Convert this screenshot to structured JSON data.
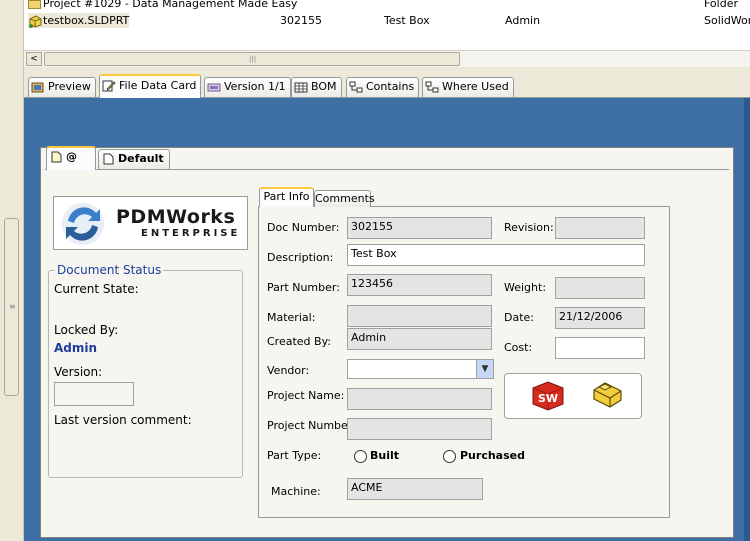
{
  "list": {
    "row1": {
      "name": "Project #1029 - Data Management Made Easy",
      "type": "Folder"
    },
    "row2": {
      "name": "testbox.SLDPRT",
      "number": "302155",
      "description": "Test Box",
      "author": "Admin",
      "type": "SolidWork"
    }
  },
  "hscroll": {
    "left_arrow": "<",
    "grip": "|||"
  },
  "tabs": [
    {
      "label": "Preview",
      "icon": "preview-icon"
    },
    {
      "label": "File Data Card",
      "icon": "edit-card-icon"
    },
    {
      "label": "Version 1/1",
      "icon": "version-icon"
    },
    {
      "label": "BOM",
      "icon": "table-icon"
    },
    {
      "label": "Contains",
      "icon": "tree-icon"
    },
    {
      "label": "Where Used",
      "icon": "tree-icon"
    }
  ],
  "card_tabs": {
    "at": "@",
    "default": "Default"
  },
  "logo": {
    "line1": "PDMWorks",
    "line2": "Enterprise"
  },
  "doc_status": {
    "legend": "Document Status",
    "current_state_label": "Current State:",
    "locked_by_label": "Locked By:",
    "locked_by_value": "Admin",
    "version_label": "Version:",
    "version_value": "",
    "last_comment_label": "Last version comment:"
  },
  "part_info": {
    "tab_part_info": "Part Info",
    "tab_comments": "Comments",
    "doc_number_label": "Doc Number:",
    "doc_number": "302155",
    "revision_label": "Revision:",
    "revision": "",
    "description_label": "Description:",
    "description": "Test Box",
    "part_number_label": "Part Number:",
    "part_number": "123456",
    "weight_label": "Weight:",
    "weight": "",
    "material_label": "Material:",
    "material": "",
    "date_label": "Date:",
    "date": "21/12/2006",
    "created_by_label": "Created By:",
    "created_by": "Admin",
    "cost_label": "Cost:",
    "cost": "",
    "vendor_label": "Vendor:",
    "vendor": "",
    "project_name_label": "Project Name:",
    "project_name": "",
    "project_number_label": "Project Number:",
    "project_number": "",
    "part_type_label": "Part Type:",
    "built_label": "Built",
    "purchased_label": "Purchased",
    "machine_label": "Machine:",
    "machine": "ACME",
    "sw_icon_text": "SW"
  },
  "colors": {
    "accent_tab": "#ffc83c",
    "background_blue": "#3d6fa5",
    "status_blue": "#1f3da0"
  }
}
